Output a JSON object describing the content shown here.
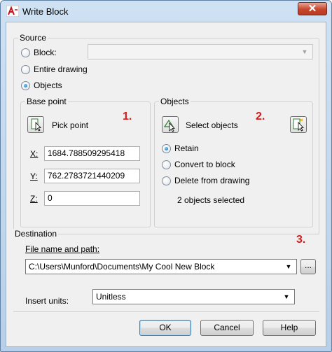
{
  "window": {
    "title": "Write Block",
    "close_glyph": "✕",
    "app_icon": "autocad-icon"
  },
  "source": {
    "label": "Source",
    "options": [
      {
        "label": "Block:",
        "selected": false
      },
      {
        "label": "Entire drawing",
        "selected": false
      },
      {
        "label": "Objects",
        "selected": true
      }
    ],
    "block_combo_value": ""
  },
  "base_point": {
    "label": "Base point",
    "pick_label": "Pick point",
    "x_label": "X:",
    "x_value": "1684.788509295418",
    "y_label": "Y:",
    "y_value": "762.2783721440209",
    "z_label": "Z:",
    "z_value": "0"
  },
  "objects": {
    "label": "Objects",
    "select_label": "Select objects",
    "options": [
      {
        "label": "Retain",
        "selected": true
      },
      {
        "label": "Convert to block",
        "selected": false
      },
      {
        "label": "Delete from drawing",
        "selected": false
      }
    ],
    "status": "2 objects selected"
  },
  "annotations": {
    "one": "1.",
    "two": "2.",
    "three": "3."
  },
  "destination": {
    "label": "Destination",
    "file_label": "File name and path:",
    "file_value": "C:\\Users\\Munford\\Documents\\My Cool New Block",
    "browse_label": "...",
    "units_label": "Insert units:",
    "units_value": "Unitless"
  },
  "buttons": {
    "ok": "OK",
    "cancel": "Cancel",
    "help": "Help"
  },
  "colors": {
    "annotation_red": "#d21d1d",
    "accent_blue": "#0f5fa8"
  }
}
